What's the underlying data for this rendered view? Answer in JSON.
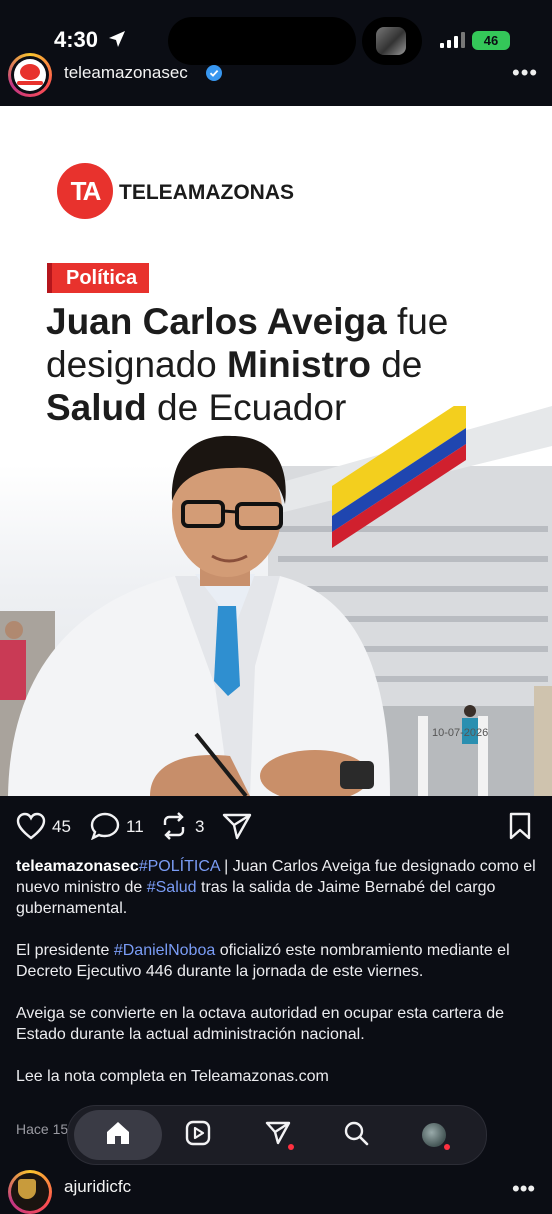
{
  "status_bar": {
    "time": "4:30",
    "battery": "46"
  },
  "post": {
    "username": "teleamazonasec",
    "image": {
      "brand_name": "TELEAMAZONAS",
      "brand_logo_text": "TA",
      "category": "Política",
      "headline": {
        "p1": "Juan Carlos Aveiga",
        "p2": " fue designado ",
        "p3": "Ministro",
        "p4": " de ",
        "p5": "Salud",
        "p6": " de Ecuador"
      },
      "date": "10-07-2026"
    },
    "actions": {
      "likes": "45",
      "comments": "11",
      "reposts": "3"
    },
    "caption": {
      "username": "teleamazonasec",
      "para1": {
        "tag1": "#POLÍTICA",
        "t1": " | Juan Carlos Aveiga fue designado como el nuevo ministro de ",
        "tag2": "#Salud",
        "t2": " tras la salida de Jaime Bernabé del cargo gubernamental."
      },
      "para2": {
        "t1": "El presidente ",
        "tag": "#DanielNoboa",
        "t2": " oficializó este nombramiento mediante el Decreto Ejecutivo 446 durante la jornada de este viernes."
      },
      "para3": "Aveiga se convierte en la octava autoridad en ocupar esta cartera de Estado durante la actual administración nacional.",
      "para4": "Lee la nota completa en Teleamazonas.com"
    },
    "posted_time": "Hace 15"
  },
  "next_post": {
    "username": "ajuridicfc"
  },
  "icons": [
    "location-arrow-icon",
    "signal-icon",
    "verified-icon",
    "more-icon",
    "heart-icon",
    "comment-icon",
    "repost-icon",
    "share-icon",
    "bookmark-icon",
    "home-icon",
    "reels-icon",
    "messages-icon",
    "search-icon",
    "profile-avatar"
  ],
  "colors": {
    "background": "#0b0d14",
    "hashtag": "#7a9cf5",
    "brand_red": "#e8322d",
    "notification": "#ff3040",
    "battery": "#34c759"
  }
}
